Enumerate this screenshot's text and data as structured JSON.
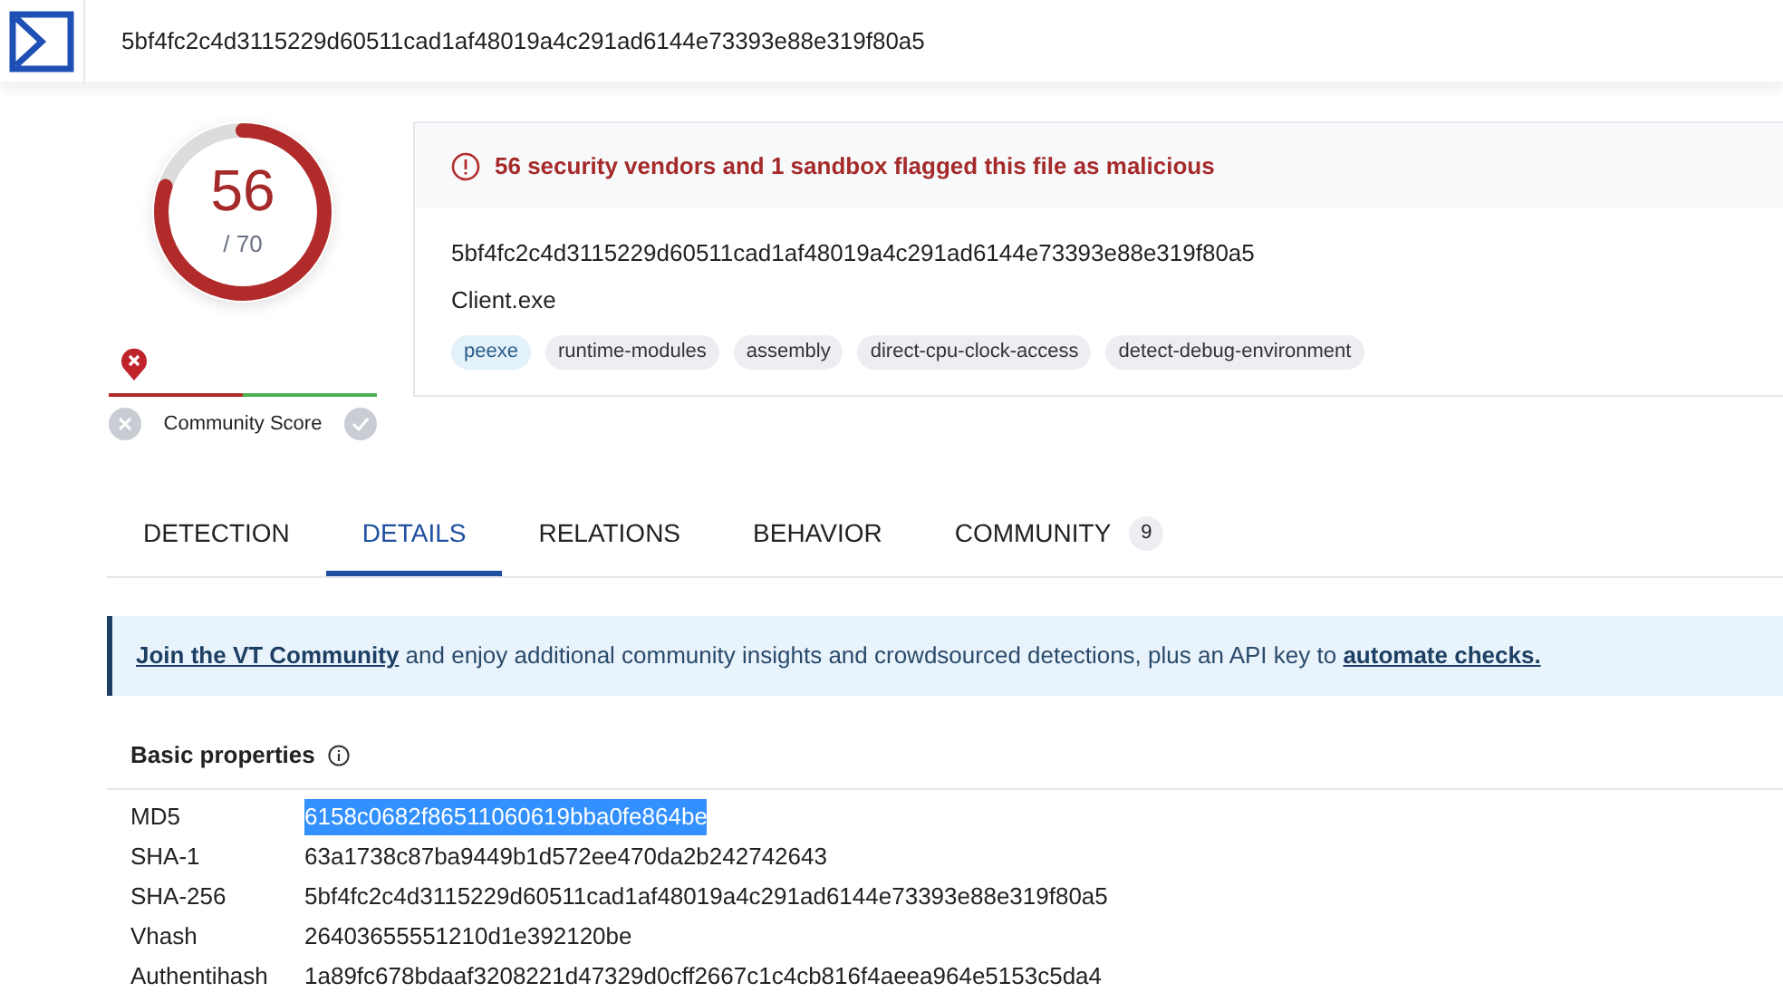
{
  "header": {
    "search_value": "5bf4fc2c4d3115229d60511cad1af48019a4c291ad6144e73393e88e319f80a5"
  },
  "score": {
    "value": "56",
    "total": "/ 70",
    "level": 0.8
  },
  "community_score": {
    "label": "Community Score"
  },
  "summary": {
    "alert": "56 security vendors and 1 sandbox flagged this file as malicious",
    "hash": "5bf4fc2c4d3115229d60511cad1af48019a4c291ad6144e73393e88e319f80a5",
    "file_name": "Client.exe",
    "tags": [
      {
        "label": "peexe",
        "highlighted": true
      },
      {
        "label": "runtime-modules",
        "highlighted": false
      },
      {
        "label": "assembly",
        "highlighted": false
      },
      {
        "label": "direct-cpu-clock-access",
        "highlighted": false
      },
      {
        "label": "detect-debug-environment",
        "highlighted": false
      }
    ]
  },
  "tabs": [
    {
      "label": "DETECTION",
      "selected": false
    },
    {
      "label": "DETAILS",
      "selected": true
    },
    {
      "label": "RELATIONS",
      "selected": false
    },
    {
      "label": "BEHAVIOR",
      "selected": false
    },
    {
      "label": "COMMUNITY",
      "selected": false,
      "count": "9"
    }
  ],
  "banner": {
    "segments": [
      {
        "kind": "link",
        "text": "Join the VT Community"
      },
      {
        "kind": "text",
        "text": " and enjoy additional community insights and crowdsourced detections, plus an API key to "
      },
      {
        "kind": "link",
        "text": "automate checks."
      }
    ]
  },
  "basic_properties": {
    "title": "Basic properties",
    "rows": [
      {
        "label": "MD5",
        "value": "6158c0682f86511060619bba0fe864be",
        "selected": true
      },
      {
        "label": "SHA-1",
        "value": "63a1738c87ba9449b1d572ee470da2b242742643",
        "selected": false
      },
      {
        "label": "SHA-256",
        "value": "5bf4fc2c4d3115229d60511cad1af48019a4c291ad6144e73393e88e319f80a5",
        "selected": false
      },
      {
        "label": "Vhash",
        "value": "26403655551210d1e392120be",
        "selected": false
      },
      {
        "label": "Authentihash",
        "value": "1a89fc678bdaaf3208221d47329d0cff2667c1c4cb816f4aeea964e5153c5da4",
        "selected": false
      }
    ]
  }
}
